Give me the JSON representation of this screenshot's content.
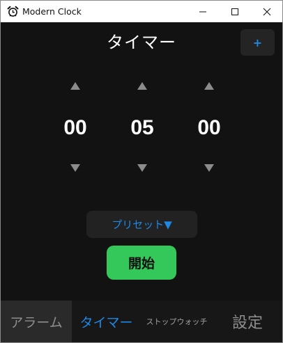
{
  "window": {
    "title": "Modern Clock",
    "app_icon": "alarm-clock-icon",
    "controls": [
      "minimize-icon",
      "maximize-icon",
      "close-icon"
    ]
  },
  "header": {
    "title": "タイマー",
    "add_label": "+"
  },
  "timer": {
    "hours": "00",
    "minutes": "05",
    "seconds": "00",
    "up_icon": "triangle-up-icon",
    "down_icon": "triangle-down-icon"
  },
  "preset": {
    "label": "プリセット▼"
  },
  "start": {
    "label": "開始",
    "color": "#34c75a"
  },
  "tabs": {
    "alarm": "アラーム",
    "timer": "タイマー",
    "stopwatch": "ストップウォッチ",
    "settings": "設定",
    "active": "timer"
  },
  "colors": {
    "accent": "#1e88e5",
    "background": "#121212",
    "start_button": "#34c75a"
  }
}
